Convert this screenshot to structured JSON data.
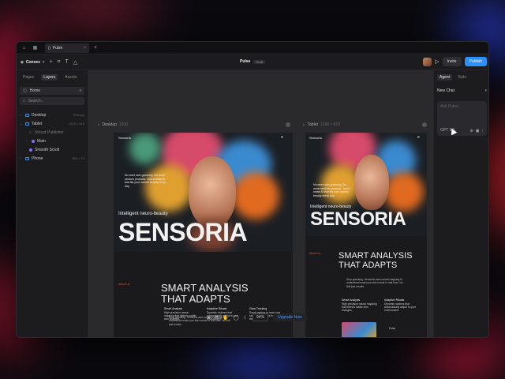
{
  "titlebar": {
    "file_tab": "Pulse",
    "close": "×",
    "new_tab": "+"
  },
  "toolbar": {
    "project": "Convex",
    "title": "Pulse",
    "badge": "Draft",
    "invite": "Invite",
    "publish": "Publish",
    "colors": {
      "publish": "#2a8fff"
    }
  },
  "left_panel": {
    "tabs": [
      "Pages",
      "Layers",
      "Assets"
    ],
    "page_select": "Home",
    "search_placeholder": "Search...",
    "layers": [
      {
        "label": "Desktop",
        "meta": "Primary"
      },
      {
        "label": "Tablet",
        "meta": "1248 × 810"
      },
      {
        "label": "Stroud Publisher",
        "meta": ""
      },
      {
        "label": "Main",
        "meta": ""
      },
      {
        "label": "Smooth Scroll",
        "meta": ""
      },
      {
        "label": "Phone",
        "meta": "390 × 14"
      }
    ]
  },
  "canvas": {
    "desktop_label": "Desktop",
    "desktop_size": "1200",
    "tablet_label": "Tablet",
    "tablet_size": "1248 × 810",
    "site": {
      "brand": "Sensoria",
      "menu": "≡",
      "blurb": "No more skin guessing. No more random products. Just a smart AI that fits your natural beauty every day.",
      "tagline": "Intelligent neuro-beauty",
      "headline": "SENSORIA",
      "about": "About Us",
      "h2_line1": "SMART ANALYSIS",
      "h2_line2": "THAT ADAPTS",
      "copy": "Stop guessing. Sensoria uses neural mapping to understand what your skin needs in real time. No fluff just results.",
      "card1_title": "Smart Analysis",
      "card1_text": "High precision neural mapping that detects subtle skin changes.",
      "card2_title": "Adaptive Rituals",
      "card2_text": "Dynamic routines that automatically adjust to your environment.",
      "card3_title": "Glow Tracking",
      "card3_text": "Smart metrics to track your radiance progress in real time.",
      "pulse": "Pulse"
    },
    "bottom_bar": {
      "zoom": "94%",
      "upgrade": "Upgrade Now"
    }
  },
  "right_panel": {
    "tabs": [
      "Agent",
      "Style"
    ],
    "chat_select": "New Chat",
    "prompt_placeholder": "Ask Pulse...",
    "model": "GPT 5.1"
  }
}
